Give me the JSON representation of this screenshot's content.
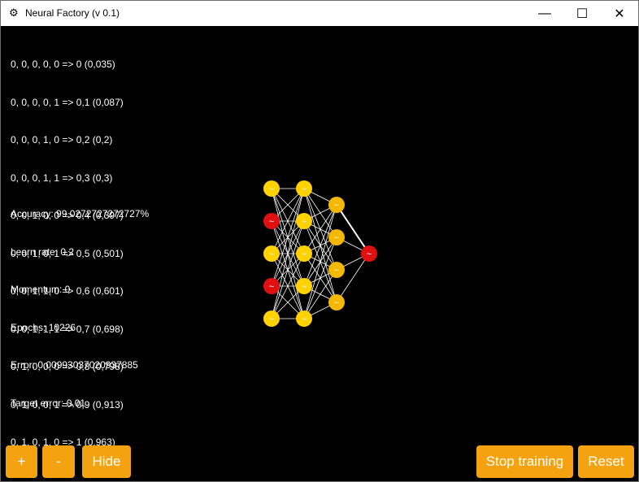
{
  "window": {
    "title": "Neural Factory (v 0.1)",
    "app_icon": "gear-icon"
  },
  "controls": {
    "minimize": "—",
    "maximize": "☐",
    "close": "✕"
  },
  "output": {
    "lines": [
      "0, 0, 0, 0, 0 => 0 (0,035)",
      "0, 0, 0, 0, 1 => 0,1 (0,087)",
      "0, 0, 0, 1, 0 => 0,2 (0,2)",
      "0, 0, 0, 1, 1 => 0,3 (0,3)",
      "0, 0, 1, 0, 0 => 0,4 (0,397)",
      "0, 0, 1, 0, 1 => 0,5 (0,501)",
      "0, 0, 1, 1, 0 => 0,6 (0,601)",
      "0, 0, 1, 1, 1 => 0,7 (0,698)",
      "0, 1, 0, 0, 0 => 0,8 (0,798)",
      "0, 1, 0, 0, 1 => 0,9 (0,913)",
      "0, 1, 0, 1, 0 => 1 (0,963)"
    ]
  },
  "stats": {
    "accuracy": "Accuracy: 99,0272727272727%",
    "learn_rate": "Learn rate: 0,2",
    "momentum": "Momentum: 0",
    "epochs": "Epochs: 10226",
    "error": "Error: 0,00993037020937885",
    "target_error": "Target error: 0,01"
  },
  "network": {
    "neuron_glyph": "~",
    "layers": [
      [
        "#ffd200",
        "#e01010",
        "#ffd200",
        "#e01010",
        "#ffd200"
      ],
      [
        "#ffd200",
        "#ffd200",
        "#ffd200",
        "#ffd200",
        "#ffd200"
      ],
      [
        "#f5b800",
        "#f5b800",
        "#f5b800",
        "#f5b800"
      ],
      [
        "#e01010"
      ]
    ],
    "colors": {
      "link": "#ffffff",
      "active": "#ffd200",
      "inactive": "#e01010",
      "hidden": "#f5b800"
    }
  },
  "buttons": {
    "plus": "+",
    "minus": "-",
    "hide": "Hide",
    "stop_training": "Stop training",
    "reset": "Reset",
    "color": "#f5a211"
  }
}
